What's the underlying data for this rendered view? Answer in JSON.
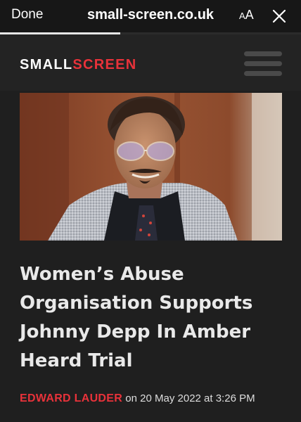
{
  "browser": {
    "done_label": "Done",
    "url": "small-screen.co.uk",
    "text_size_small": "A",
    "text_size_big": "A",
    "close_icon": "close-icon",
    "load_progress": 0.4
  },
  "site": {
    "logo_part1": "SMALL",
    "logo_part2": "SCREEN",
    "brand_color": "#e8323a",
    "menu_icon": "hamburger-menu-icon"
  },
  "article": {
    "headline": "Women’s Abuse Organisation Supports Johnny Depp In Amber Heard Trial",
    "author": "EDWARD LAUDER",
    "date_text": "on 20 May 2022 at 3:26 PM",
    "hero_image": "photo of Johnny Depp in tinted glasses and grey suit"
  }
}
